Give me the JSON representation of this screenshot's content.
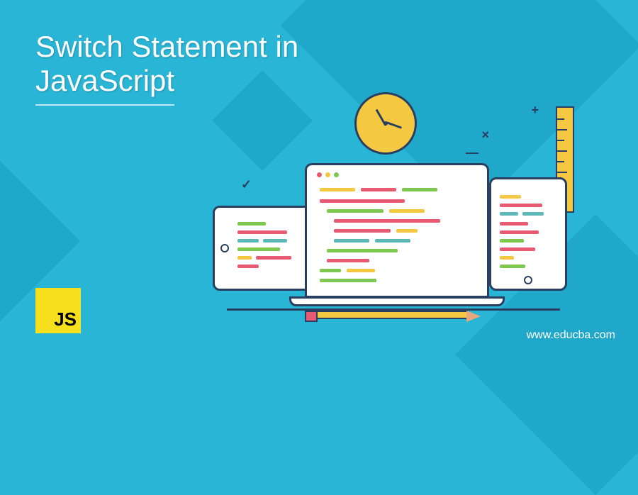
{
  "title_line1": "Switch Statement in",
  "title_line2": "JavaScript",
  "logo_text": "JS",
  "url": "www.educba.com"
}
